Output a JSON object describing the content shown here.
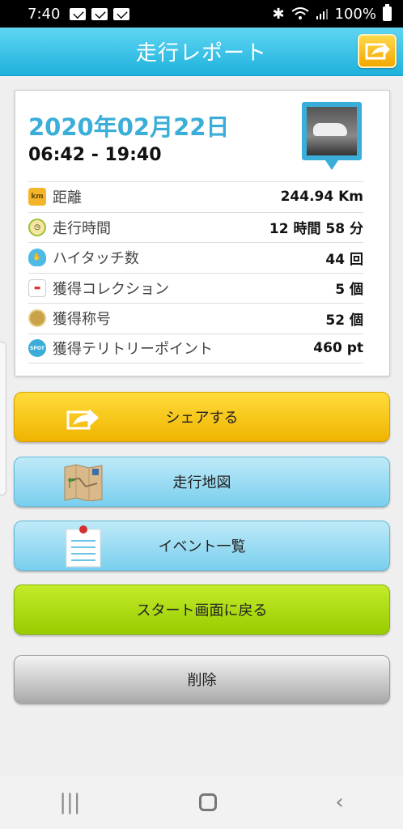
{
  "status_bar": {
    "time": "7:40",
    "battery": "100%"
  },
  "header": {
    "title": "走行レポート"
  },
  "report": {
    "date": "2020年02月22日",
    "time_range": "06:42 - 19:40",
    "stats": [
      {
        "icon": "km-icon",
        "icon_text": "km",
        "label": "距離",
        "value": "244.94 Km"
      },
      {
        "icon": "clock-icon",
        "icon_text": "",
        "label": "走行時間",
        "value": "12 時間 58 分"
      },
      {
        "icon": "hand-icon",
        "icon_text": "",
        "label": "ハイタッチ数",
        "value": "44 回"
      },
      {
        "icon": "car-icon",
        "icon_text": "",
        "label": "獲得コレクション",
        "value": "5 個"
      },
      {
        "icon": "medal-icon",
        "icon_text": "",
        "label": "獲得称号",
        "value": "52 個"
      },
      {
        "icon": "spot-icon",
        "icon_text": "",
        "label": "獲得テリトリーポイント",
        "value": "460 pt"
      }
    ]
  },
  "buttons": {
    "share": "シェアする",
    "map": "走行地図",
    "events": "イベント一覧",
    "start": "スタート画面に戻る",
    "delete": "削除"
  },
  "colors": {
    "header": "#1fb1dd",
    "date_text": "#3aaed8",
    "share_button": "#f0b400",
    "start_button": "#98cc00"
  }
}
